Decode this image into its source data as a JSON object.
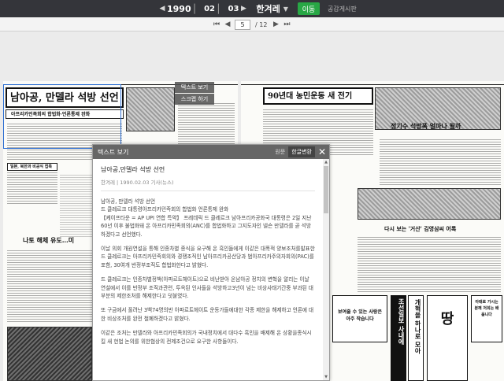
{
  "toolbar": {
    "year": "1990",
    "month": "02",
    "day": "03",
    "newspaper": "한겨레",
    "go_label": "이동",
    "guide_label": "공감게시판"
  },
  "pager": {
    "current": "5",
    "total": "/ 12"
  },
  "left_page": {
    "headline": "남아공, 만델라 석방 선언",
    "subhead": "아프리카민족회의 합법화·언론통제 완화",
    "mid_headline": "나토 해체 유도…미",
    "box_text": "일본, 북한과 비공식 접촉"
  },
  "right_page": {
    "headline": "90년대 농민운동 새 전기",
    "headline2": "정기수 석방폭 얼마나 될까",
    "banner": "다시 보는 '거산' 김영삼씨 어록",
    "ad1": "보여줄 수 있는 사랑은 아주 작습니다",
    "ad2": "땅",
    "vertical1": "조선일보 사내에",
    "vertical2": "개혁을 하나로 모아",
    "bottom_box": "아태로 가시는 분께 저희는 배웁니다"
  },
  "side_buttons": {
    "text_view": "텍스트 보기",
    "scrap": "스크랩 하기"
  },
  "popup": {
    "title": "텍스트 보기",
    "lang_original": "원문",
    "lang_modern": "한글변환",
    "article_title": "남아공,만델라 석방 선언",
    "meta": "한겨레 | 1990.02.03 기사(뉴스)",
    "paragraphs": [
      "남아공, 만델라 석방 선언\n드 클레르크 대통령아프리카민족회의 합법화 언론통제 완화\n【케이프타운 = AP UPI 연합 특약】 프레데릭 드 클레르크 남아프리카공화국 대통령은 2일 지난 60년 이후 불법화돼 온 아프리카민족회의(ANC)를 합법화하고 그지도자인 넬슨 만델라를 곧 석방하겠다고 선언했다.",
      "이날 의회 개원연설을 통해 인종차별 종식을 요구해 온 흑인들에게 이같은 대폭적 양보조처를발표한 드 클레르크는 아프리카민족회의와 경쟁조직인 남아프리카공산당과 범아프리카주의자회의(PAC)를 포함, 30여개 반정부조직도 합법화한다고 밝혔다.",
      "드 클레르크는 인종차별정책(아파르트헤이트)으로 비난받아 온남아공 정치의 변혁을 알리는 이날 연설에서 이를 반정부 조직과관련, 투옥된 인사들을 석방하고3년이 넘는 비상사태기간중 부과된 대부분의 제한조처를 해제한다고 덧붙였다.",
      "또 구금에서 풀려난 3백74명의반 아파르트헤이트 운동가들에대한 각종 제한을 해제하고 언론에 대한 비상조처를 완전 철폐하겠다고 밝혔다.",
      "이같은 조처는 만델라와 아프리카민족회의가 국내정치에서 대다수 흑인을 배제해 온 상황을종식시킬 새 헌법 논의를 위한협상의 전제조건으로 요구한 사항들이다."
    ]
  }
}
